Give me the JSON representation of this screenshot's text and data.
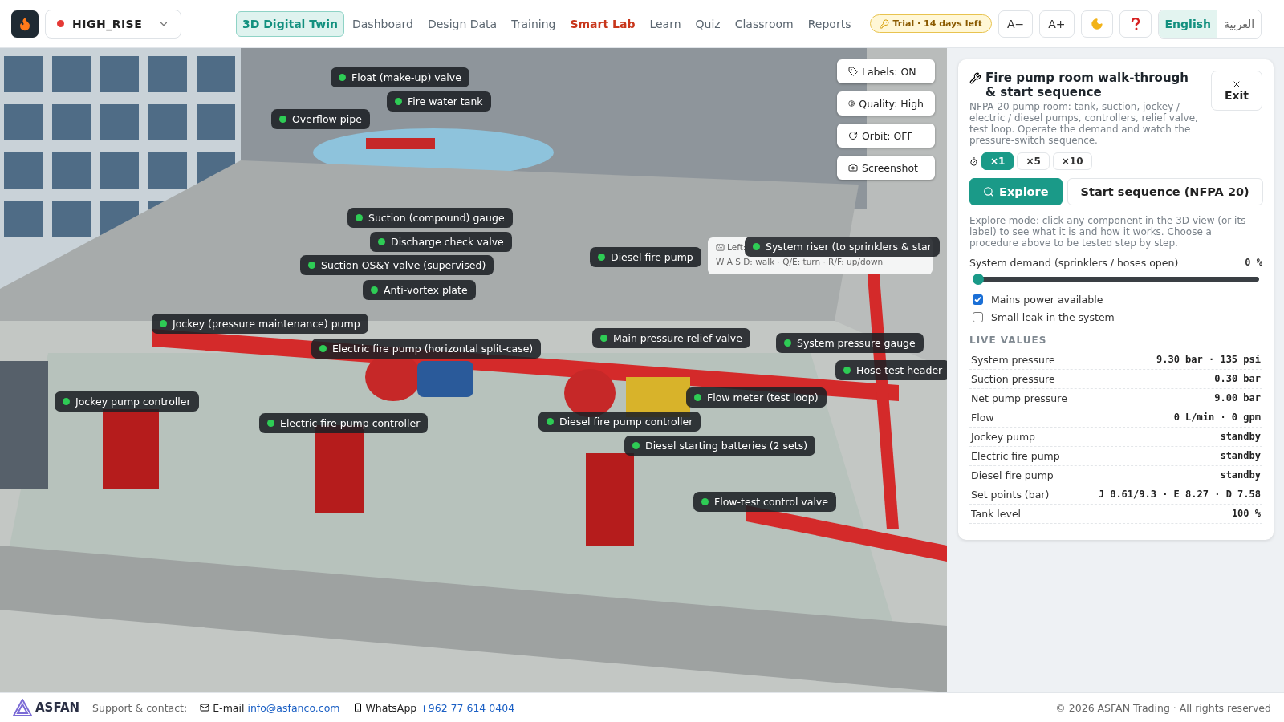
{
  "header": {
    "project": {
      "name": "HIGH_RISE",
      "color": "#e53935"
    },
    "nav": [
      {
        "label": "3D Digital Twin",
        "selected": true,
        "kind": "normal"
      },
      {
        "label": "Dashboard",
        "selected": false,
        "kind": "normal"
      },
      {
        "label": "Design Data",
        "selected": false,
        "kind": "normal"
      },
      {
        "label": "Training",
        "selected": false,
        "kind": "normal"
      },
      {
        "label": "Smart Lab",
        "selected": false,
        "kind": "highlight"
      },
      {
        "label": "Learn",
        "selected": false,
        "kind": "normal"
      },
      {
        "label": "Quiz",
        "selected": false,
        "kind": "normal"
      },
      {
        "label": "Classroom",
        "selected": false,
        "kind": "normal"
      },
      {
        "label": "Reports",
        "selected": false,
        "kind": "normal"
      }
    ],
    "trial": "Trial · 14 days left",
    "font_buttons": [
      "A−",
      "A+"
    ],
    "languages": [
      {
        "label": "English",
        "selected": true
      },
      {
        "label": "العربية",
        "selected": false
      }
    ]
  },
  "viewport": {
    "controls": [
      "Labels: ON",
      "Quality: High",
      "Orbit: OFF",
      "Screenshot"
    ],
    "hint": {
      "title": "Left:",
      "keys": "W A S D: walk · Q/E: turn · R/F: up/down"
    },
    "labels": [
      "Float (make-up) valve",
      "Fire water tank",
      "Overflow pipe",
      "Suction (compound) gauge",
      "Discharge check valve",
      "Suction OS&Y valve (supervised)",
      "Diesel fire pump",
      "System riser (to sprinklers & star",
      "Anti-vortex plate",
      "Jockey (pressure maintenance) pump",
      "Electric fire pump (horizontal split-case)",
      "Main pressure relief valve",
      "System pressure gauge",
      "Hose test header",
      "Jockey pump controller",
      "Flow meter (test loop)",
      "Electric fire pump controller",
      "Diesel fire pump controller",
      "Diesel starting batteries (2 sets)",
      "Flow-test control valve"
    ]
  },
  "panel": {
    "title": "Fire pump room walk-through & start sequence",
    "exit": "Exit",
    "description": "NFPA 20 pump room: tank, suction, jockey / electric / diesel pumps, controllers, relief valve, test loop. Operate the demand and watch the pressure-switch sequence.",
    "speeds": [
      {
        "label": "×1",
        "selected": true
      },
      {
        "label": "×5",
        "selected": false
      },
      {
        "label": "×10",
        "selected": false
      }
    ],
    "modes": [
      {
        "label": "Explore",
        "selected": true
      },
      {
        "label": "Start sequence (NFPA 20)",
        "selected": false
      }
    ],
    "mode_help": "Explore mode: click any component in the 3D view (or its label) to see what it is and how it works. Choose a procedure above to be tested step by step.",
    "demand": {
      "label": "System demand (sprinklers / hoses open)",
      "reading": "0 %",
      "level": 0
    },
    "options": [
      {
        "label": "Mains power available",
        "checked": true
      },
      {
        "label": "Small leak in the system",
        "checked": false
      }
    ],
    "live_title": "LIVE VALUES",
    "live_values": [
      {
        "name": "System pressure",
        "value": "9.30 bar · 135 psi"
      },
      {
        "name": "Suction pressure",
        "value": "0.30 bar"
      },
      {
        "name": "Net pump pressure",
        "value": "9.00 bar"
      },
      {
        "name": "Flow",
        "value": "0 L/min · 0 gpm"
      },
      {
        "name": "Jockey pump",
        "value": "standby"
      },
      {
        "name": "Electric fire pump",
        "value": "standby"
      },
      {
        "name": "Diesel fire pump",
        "value": "standby"
      },
      {
        "name": "Set points (bar)",
        "value": "J 8.61/9.3 · E 8.27 · D 7.58"
      },
      {
        "name": "Tank level",
        "value": "100 %"
      }
    ]
  },
  "footer": {
    "brand": "ASFAN",
    "support": "Support & contact:",
    "email_label": "E-mail",
    "email": "info@asfanco.com",
    "whatsapp_label": "WhatsApp",
    "phone": "+962 77 614 0404",
    "copyright": "© 2026 ASFAN Trading · All rights reserved"
  }
}
